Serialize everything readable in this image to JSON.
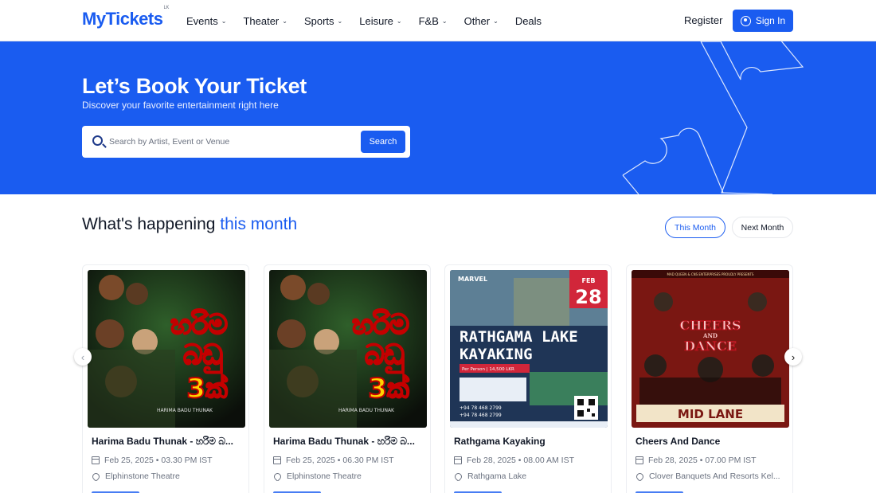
{
  "brand": {
    "logo": "MyTickets",
    "logo_suffix": "LK"
  },
  "nav": {
    "items": [
      {
        "label": "Events",
        "dropdown": true
      },
      {
        "label": "Theater",
        "dropdown": true
      },
      {
        "label": "Sports",
        "dropdown": true
      },
      {
        "label": "Leisure",
        "dropdown": true
      },
      {
        "label": "F&B",
        "dropdown": true
      },
      {
        "label": "Other",
        "dropdown": true
      },
      {
        "label": "Deals",
        "dropdown": false
      }
    ],
    "register": "Register",
    "signin": "Sign In"
  },
  "hero": {
    "title": "Let’s Book Your Ticket",
    "subtitle": "Discover your favorite entertainment right here",
    "search_placeholder": "Search by Artist, Event or Venue",
    "search_button": "Search"
  },
  "section": {
    "title_prefix": "What's happening ",
    "title_accent": "this month",
    "tabs": {
      "this_month": "This Month",
      "next_month": "Next Month"
    }
  },
  "events": [
    {
      "title": "Harima Badu Thunak - හරිම බ...",
      "date": "Feb 25, 2025 • 03.30 PM IST",
      "venue": "Elphinstone Theatre"
    },
    {
      "title": "Harima Badu Thunak - හරිම බ...",
      "date": "Feb 25, 2025 • 06.30 PM IST",
      "venue": "Elphinstone Theatre"
    },
    {
      "title": "Rathgama Kayaking",
      "date": "Feb 28, 2025 • 08.00 AM IST",
      "venue": "Rathgama Lake"
    },
    {
      "title": "Cheers And Dance",
      "date": "Feb 28, 2025 • 07.00 PM IST",
      "venue": "Clover Banquets And Resorts Kel..."
    }
  ],
  "posters": {
    "harima": {
      "line1": "හරිම",
      "line2": "බඩු",
      "line3": "3ක්",
      "caption": "HARIMA BADU THUNAK"
    },
    "kayak": {
      "brand": "MARVEL",
      "month": "FEB",
      "day": "28",
      "title1": "RATHGAMA LAKE",
      "title2": "KAYAKING",
      "price": "Per Person | 14,500 LKR",
      "phone1": "+94 78 468 2799",
      "phone2": "+94 78 468 2799"
    },
    "cheers": {
      "header": "MAD QUEEN & CNS ENTERPRISES PROUDLY PRESENTS",
      "title1": "CHEERS",
      "and": "AND",
      "title2": "DANCE",
      "venue": "MID LANE"
    }
  },
  "colors": {
    "primary": "#1a5cf0"
  }
}
